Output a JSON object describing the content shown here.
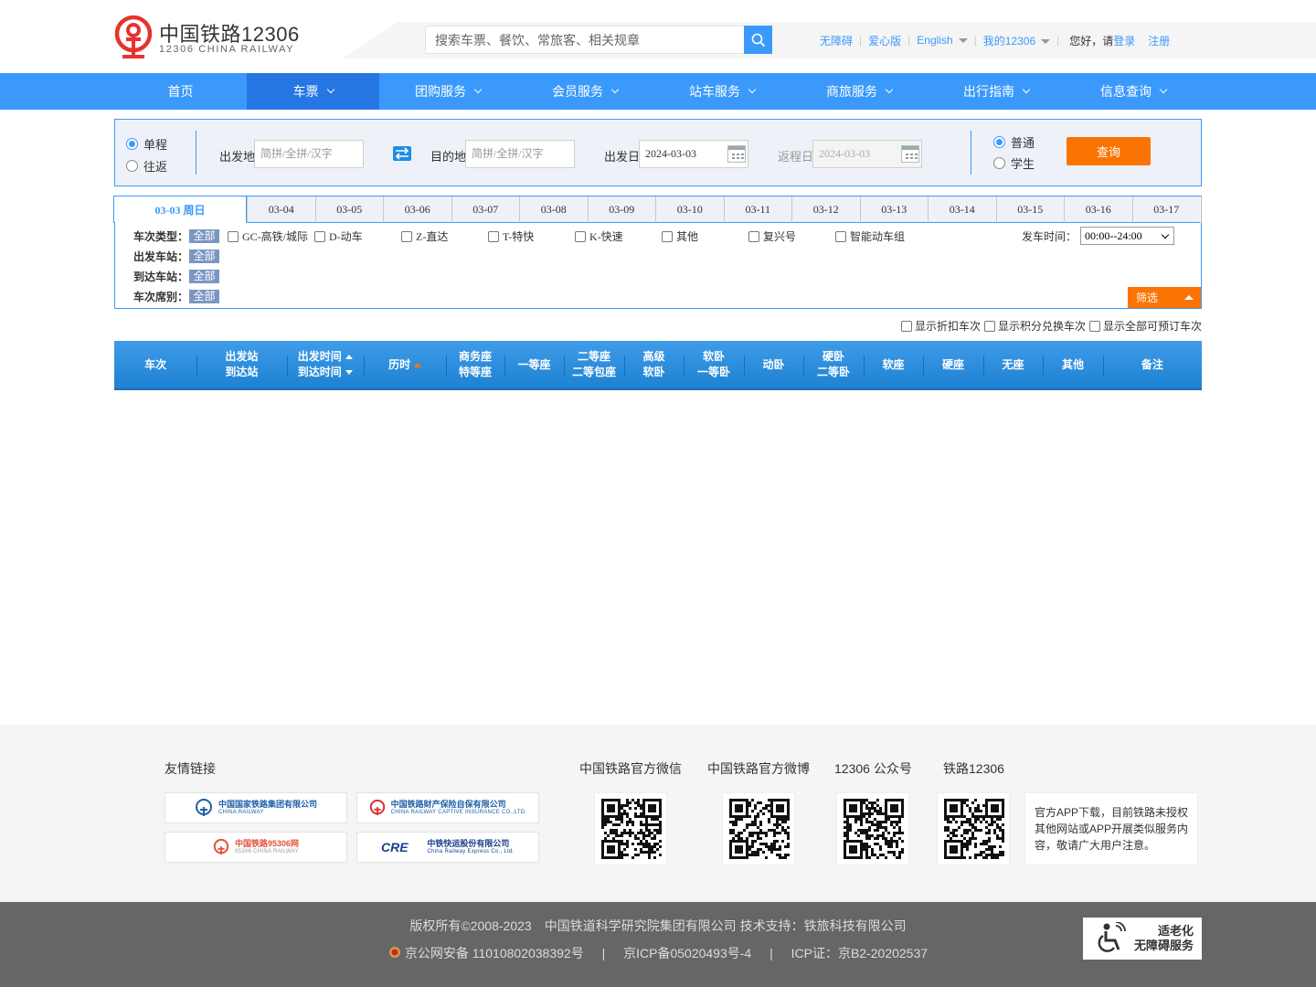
{
  "header": {
    "logo_cn": "中国铁路12306",
    "logo_en": "12306 CHINA RAILWAY",
    "search_placeholder": "搜索车票、餐饮、常旅客、相关规章",
    "links": {
      "accessible": "无障碍",
      "care": "爱心版",
      "english": "English",
      "my12306": "我的12306",
      "greeting": "您好，请",
      "login": "登录",
      "register": "注册"
    }
  },
  "nav": {
    "items": [
      {
        "label": "首页",
        "has_menu": false
      },
      {
        "label": "车票",
        "has_menu": true
      },
      {
        "label": "团购服务",
        "has_menu": true
      },
      {
        "label": "会员服务",
        "has_menu": true
      },
      {
        "label": "站车服务",
        "has_menu": true
      },
      {
        "label": "商旅服务",
        "has_menu": true
      },
      {
        "label": "出行指南",
        "has_menu": true
      },
      {
        "label": "信息查询",
        "has_menu": true
      }
    ],
    "active_index": 1
  },
  "query": {
    "trip_one_way": "单程",
    "trip_round": "往返",
    "from_label": "出发地",
    "from_placeholder": "简拼/全拼/汉字",
    "to_label": "目的地",
    "to_placeholder": "简拼/全拼/汉字",
    "depart_label": "出发日",
    "depart_date": "2024-03-03",
    "return_label": "返程日",
    "return_date": "2024-03-03",
    "type_normal": "普通",
    "type_student": "学生",
    "search_button": "查询"
  },
  "dates": {
    "current": "03-03 周日",
    "others": [
      "03-04",
      "03-05",
      "03-06",
      "03-07",
      "03-08",
      "03-09",
      "03-10",
      "03-11",
      "03-12",
      "03-13",
      "03-14",
      "03-15",
      "03-16",
      "03-17"
    ]
  },
  "filter": {
    "train_type_label": "车次类型：",
    "from_station_label": "出发车站：",
    "to_station_label": "到达车站：",
    "seat_label": "车次席别：",
    "all_tag": "全部",
    "train_types": [
      "GC-高铁/城际",
      "D-动车",
      "Z-直达",
      "T-特快",
      "K-快速",
      "其他",
      "复兴号",
      "智能动车组"
    ],
    "dep_time_label": "发车时间：",
    "dep_time_value": "00:00--24:00",
    "filter_button": "筛选"
  },
  "options": {
    "discount": "显示折扣车次",
    "points": "显示积分兑换车次",
    "all_bookable": "显示全部可预订车次"
  },
  "table_header": {
    "train_no": "车次",
    "from_station": "出发站",
    "to_station": "到达站",
    "dep_time": "出发时间",
    "arr_time": "到达时间",
    "duration": "历时",
    "business": "商务座",
    "premium": "特等座",
    "first": "一等座",
    "second": "二等座",
    "second_box": "二等包座",
    "senior": "高级",
    "senior2": "软卧",
    "soft_sleeper": "软卧",
    "first_sleeper": "一等卧",
    "emu_sleeper": "动卧",
    "hard_sleeper": "硬卧",
    "second_sleeper": "二等卧",
    "soft_seat": "软座",
    "hard_seat": "硬座",
    "no_seat": "无座",
    "other": "其他",
    "remark": "备注"
  },
  "footer": {
    "friend_links": "友情链接",
    "partners": [
      {
        "cn": "中国国家铁路集团有限公司",
        "en": "CHINA RAILWAY"
      },
      {
        "cn": "中国铁路财产保险自保有限公司",
        "en": "CHINA RAILWAY CAPTIVE INSURANCE CO.,LTD."
      },
      {
        "cn": "中国铁路95306网",
        "en": "95306 CHINA RAILWAY"
      },
      {
        "cn": "中铁快运股份有限公司",
        "en": "China Railway Express Co., Ltd."
      }
    ],
    "wechat": "中国铁路官方微信",
    "weibo": "中国铁路官方微博",
    "public_account": "12306 公众号",
    "app": "铁路12306",
    "app_note": "官方APP下载，目前铁路未授权其他网站或APP开展类似服务内容，敬请广大用户注意。",
    "copyright": "版权所有©2008-2023　中国铁道科学研究院集团有限公司 技术支持：铁旅科技有限公司",
    "beian_police": "京公网安备 11010802038392号",
    "icp": "京ICP备05020493号-4",
    "icp_license": "ICP证：京B2-20202537",
    "sep": "|",
    "aging_line1": "适老化",
    "aging_line2": "无障碍服务"
  },
  "colors": {
    "brand_blue": "#3b99fc",
    "active_nav": "#2676e3",
    "orange": "#fb7403",
    "logo_red": "#e53330"
  }
}
